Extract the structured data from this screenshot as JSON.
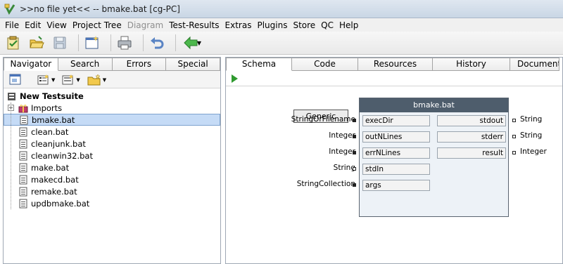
{
  "window": {
    "title": ">>no file yet<< -- bmake.bat [cg-PC]"
  },
  "menu": [
    {
      "label": "File",
      "disabled": false
    },
    {
      "label": "Edit",
      "disabled": false
    },
    {
      "label": "View",
      "disabled": false
    },
    {
      "label": "Project Tree",
      "disabled": false
    },
    {
      "label": "Diagram",
      "disabled": true
    },
    {
      "label": "Test-Results",
      "disabled": false
    },
    {
      "label": "Extras",
      "disabled": false
    },
    {
      "label": "Plugins",
      "disabled": false
    },
    {
      "label": "Store",
      "disabled": false
    },
    {
      "label": "QC",
      "disabled": false
    },
    {
      "label": "Help",
      "disabled": false
    }
  ],
  "toolbar_icons": [
    "new-testsuite-icon",
    "open-folder-icon",
    "save-icon",
    "new-window-icon",
    "print-icon",
    "undo-icon",
    "back-arrow-icon"
  ],
  "navigator": {
    "tabs": [
      "Navigator",
      "Search",
      "Errors",
      "Special"
    ],
    "root": "New Testsuite",
    "items": [
      {
        "label": "Imports",
        "icon": "gift-icon",
        "selected": false
      },
      {
        "label": "bmake.bat",
        "icon": "script-file-icon",
        "selected": true
      },
      {
        "label": "clean.bat",
        "icon": "script-file-icon",
        "selected": false
      },
      {
        "label": "cleanjunk.bat",
        "icon": "script-file-icon",
        "selected": false
      },
      {
        "label": "cleanwin32.bat",
        "icon": "script-file-icon",
        "selected": false
      },
      {
        "label": "make.bat",
        "icon": "script-file-icon",
        "selected": false
      },
      {
        "label": "makecd.bat",
        "icon": "script-file-icon",
        "selected": false
      },
      {
        "label": "remake.bat",
        "icon": "script-file-icon",
        "selected": false
      },
      {
        "label": "updbmake.bat",
        "icon": "script-file-icon",
        "selected": false
      }
    ]
  },
  "editor": {
    "tabs": [
      "Schema",
      "Code",
      "Resources",
      "History",
      "Documentation"
    ],
    "generic_label": "Generic",
    "block": {
      "title": "bmake.bat",
      "inputs": [
        {
          "name": "execDir",
          "type": "StringOrFilename",
          "filled": true
        },
        {
          "name": "outNLines",
          "type": "Integer",
          "filled": true
        },
        {
          "name": "errNLines",
          "type": "Integer",
          "filled": true
        },
        {
          "name": "stdIn",
          "type": "String",
          "filled": false
        },
        {
          "name": "args",
          "type": "StringCollection",
          "filled": true
        }
      ],
      "outputs": [
        {
          "name": "stdout",
          "type": "String"
        },
        {
          "name": "stderr",
          "type": "String"
        },
        {
          "name": "result",
          "type": "Integer"
        }
      ]
    }
  }
}
